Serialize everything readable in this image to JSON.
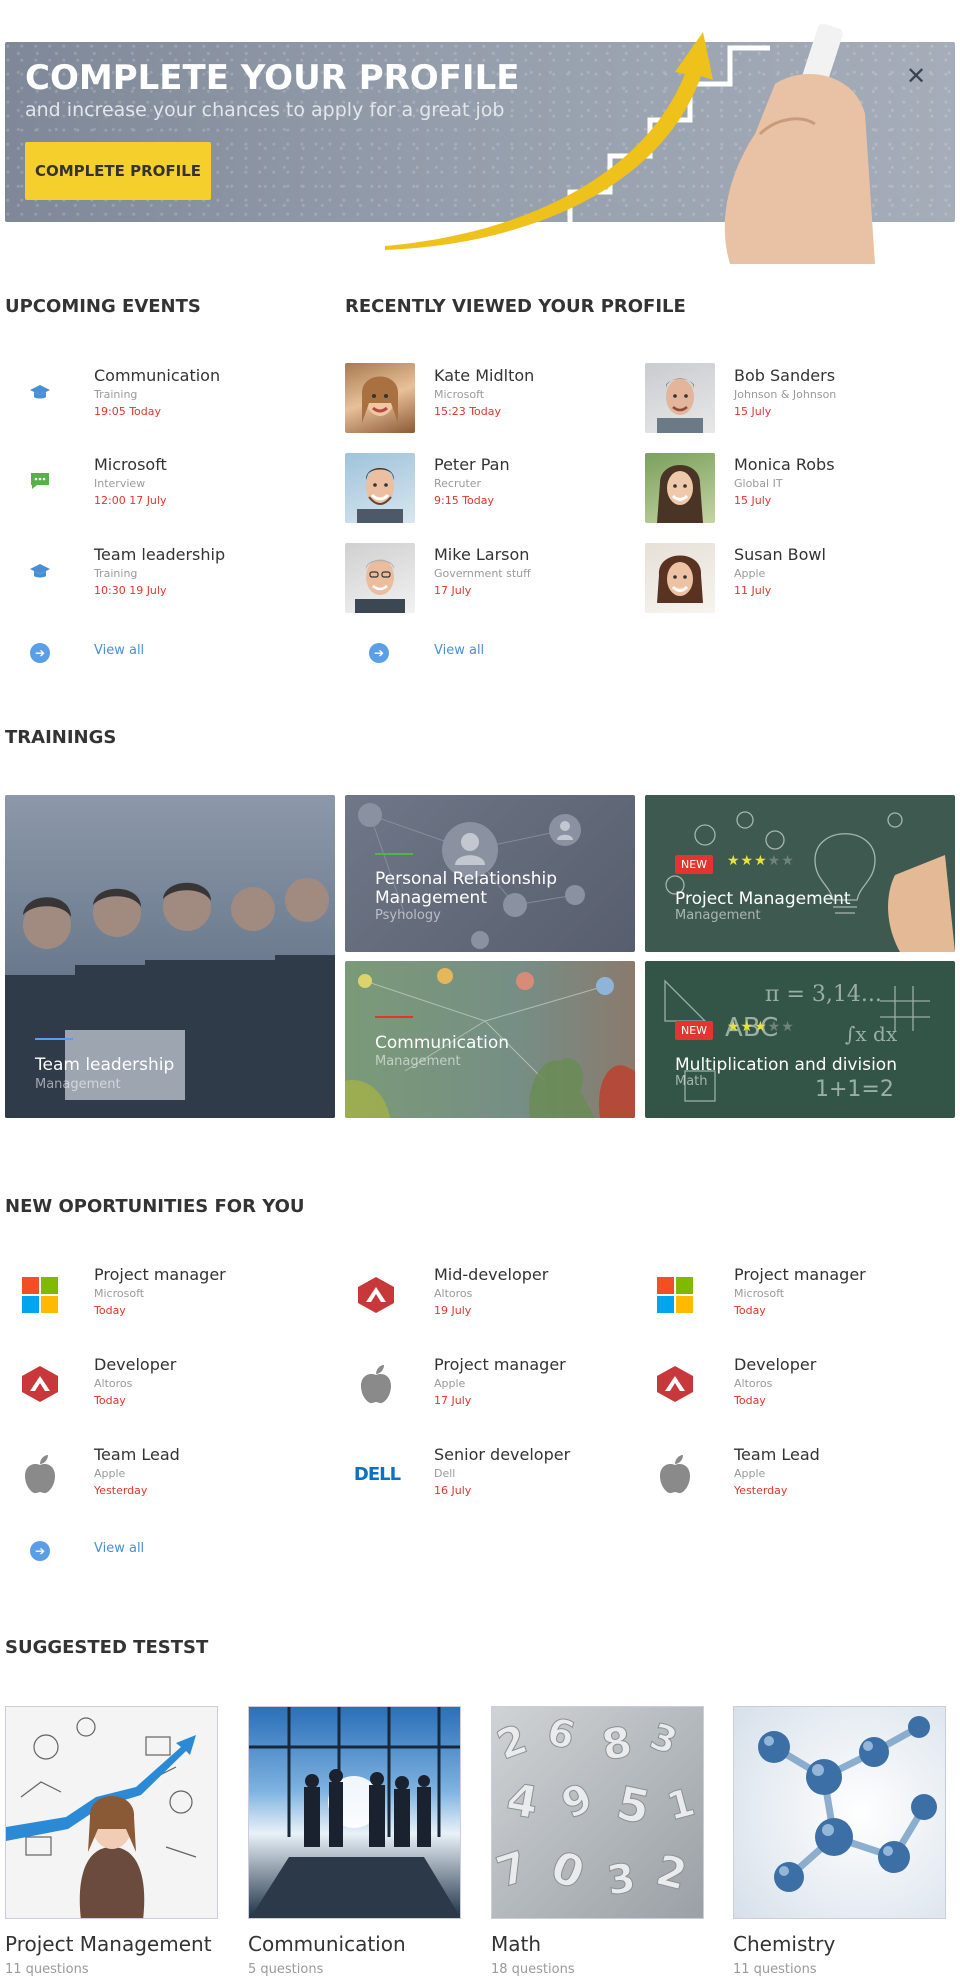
{
  "banner": {
    "title": "COMPLETE YOUR PROFILE",
    "subtitle": "and increase your chances to apply for a great job",
    "button": "COMPLETE PROFILE",
    "close_icon": "close-icon"
  },
  "events": {
    "heading": "UPCOMING EVENTS",
    "items": [
      {
        "title": "Communication",
        "type": "Training",
        "time": "19:05  Today",
        "icon": "graduation-cap-icon"
      },
      {
        "title": "Microsoft",
        "type": "Interview",
        "time": "12:00  17 July",
        "icon": "chat-icon"
      },
      {
        "title": "Team leadership",
        "type": "Training",
        "time": "10:30  19 July",
        "icon": "graduation-cap-icon"
      }
    ],
    "view_all": "View all"
  },
  "profile_views": {
    "heading": "RECENTLY VIEWED YOUR PROFILE",
    "items": [
      {
        "name": "Kate Midlton",
        "company": "Microsoft",
        "time": "15:23  Today"
      },
      {
        "name": "Bob Sanders",
        "company": "Johnson & Johnson",
        "time": "15 July"
      },
      {
        "name": "Peter Pan",
        "company": "Recruter",
        "time": "9:15  Today"
      },
      {
        "name": "Monica Robs",
        "company": "Global IT",
        "time": "15 July"
      },
      {
        "name": "Mike Larson",
        "company": "Government stuff",
        "time": "17 July"
      },
      {
        "name": "Susan Bowl",
        "company": "Apple",
        "time": "11 July"
      }
    ],
    "view_all": "View all"
  },
  "trainings": {
    "heading": "TRAININGS",
    "cards": [
      {
        "title": "Team leadership",
        "category": "Management",
        "new": false
      },
      {
        "title": "Personal Relationship Management",
        "category": "Psyhology",
        "new": false
      },
      {
        "title": "Project Management",
        "category": "Management",
        "new": true,
        "badge": "NEW",
        "stars": 3
      },
      {
        "title": "Communication",
        "category": "Management",
        "new": false
      },
      {
        "title": "Multiplication and division",
        "category": "Math",
        "new": true,
        "badge": "NEW",
        "stars": 3
      }
    ]
  },
  "opportunities": {
    "heading": "NEW OPORTUNITIES FOR YOU",
    "items": [
      {
        "title": "Project manager",
        "company": "Microsoft",
        "time": "Today",
        "logo": "microsoft-logo"
      },
      {
        "title": "Mid-developer",
        "company": "Altoros",
        "time": "19 July",
        "logo": "altoros-logo"
      },
      {
        "title": "Project manager",
        "company": "Microsoft",
        "time": "Today",
        "logo": "microsoft-logo"
      },
      {
        "title": "Developer",
        "company": "Altoros",
        "time": "Today",
        "logo": "altoros-logo"
      },
      {
        "title": "Project manager",
        "company": "Apple",
        "time": "17 July",
        "logo": "apple-logo"
      },
      {
        "title": "Developer",
        "company": "Altoros",
        "time": "Today",
        "logo": "altoros-logo"
      },
      {
        "title": "Team Lead",
        "company": "Apple",
        "time": "Yesterday",
        "logo": "apple-logo"
      },
      {
        "title": "Senior developer",
        "company": "Dell",
        "time": "16 July",
        "logo": "dell-logo"
      },
      {
        "title": "Team Lead",
        "company": "Apple",
        "time": "Yesterday",
        "logo": "apple-logo"
      }
    ],
    "view_all": "View all",
    "dell_logo_text": "DELL"
  },
  "tests": {
    "heading": "SUGGESTED TESTST",
    "items": [
      {
        "title": "Project Management",
        "count": "11 questions"
      },
      {
        "title": "Communication",
        "count": "5 questions"
      },
      {
        "title": "Math",
        "count": "18 questions"
      },
      {
        "title": "Chemistry",
        "count": "11 questions"
      }
    ]
  },
  "colors": {
    "accent_yellow": "#f5cf2b",
    "date_red": "#e3342f",
    "link_blue": "#4a8fd6"
  }
}
